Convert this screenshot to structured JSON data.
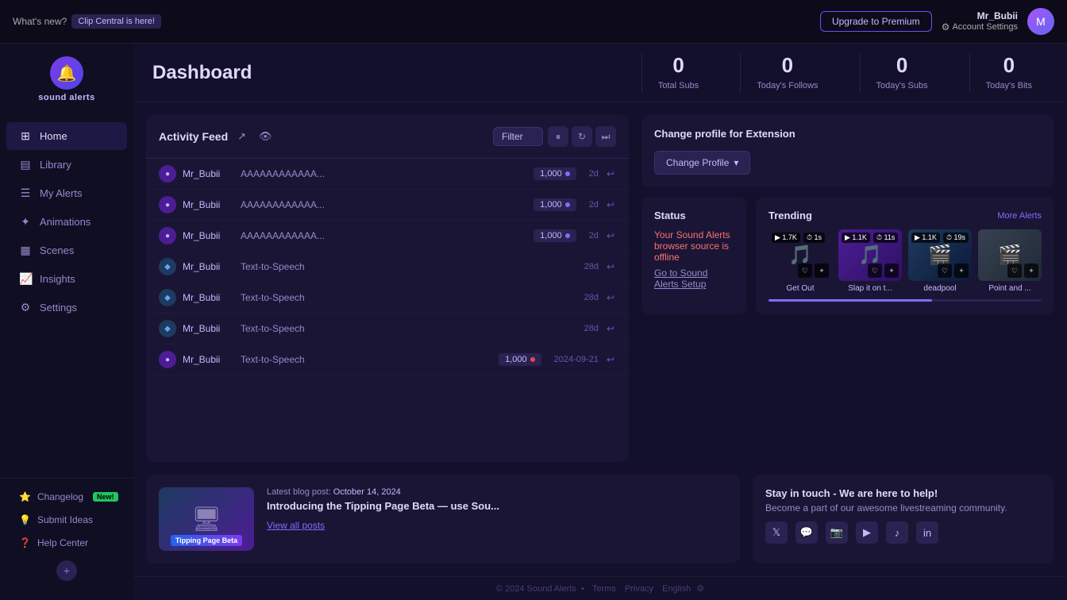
{
  "topbar": {
    "announcement_label": "What's new?",
    "announcement_link": "Clip Central is here!",
    "upgrade_btn": "Upgrade to Premium",
    "username": "Mr_Bubii",
    "account_settings": "Account Settings"
  },
  "sidebar": {
    "logo_text": "sound alerts",
    "items": [
      {
        "id": "home",
        "label": "Home",
        "icon": "⊞",
        "active": true
      },
      {
        "id": "library",
        "label": "Library",
        "icon": "📚"
      },
      {
        "id": "my-alerts",
        "label": "My Alerts",
        "icon": "☰"
      },
      {
        "id": "animations",
        "label": "Animations",
        "icon": "✨"
      },
      {
        "id": "scenes",
        "label": "Scenes",
        "icon": "🎬"
      },
      {
        "id": "insights",
        "label": "Insights",
        "icon": "📊"
      },
      {
        "id": "settings",
        "label": "Settings",
        "icon": "⚙"
      }
    ],
    "bottom_items": [
      {
        "id": "changelog",
        "label": "Changelog",
        "badge": "New!",
        "icon": "⭐"
      },
      {
        "id": "submit-ideas",
        "label": "Submit Ideas",
        "icon": "💡"
      },
      {
        "id": "help-center",
        "label": "Help Center",
        "icon": "❓"
      }
    ]
  },
  "stats": {
    "items": [
      {
        "value": "0",
        "label": "Total Subs"
      },
      {
        "value": "0",
        "label": "Today's Follows"
      },
      {
        "value": "0",
        "label": "Today's Subs"
      },
      {
        "value": "0",
        "label": "Today's Bits"
      }
    ]
  },
  "activity_feed": {
    "title": "Activity Feed",
    "filter_label": "Filter",
    "items": [
      {
        "username": "Mr_Bubii",
        "type": "AAAAAAAAAAAA...",
        "points": "1,000",
        "dot_type": "purple",
        "time": "2d",
        "dot_color": "purple"
      },
      {
        "username": "Mr_Bubii",
        "type": "AAAAAAAAAAAA...",
        "points": "1,000",
        "dot_type": "purple",
        "time": "2d",
        "dot_color": "purple"
      },
      {
        "username": "Mr_Bubii",
        "type": "AAAAAAAAAAAA...",
        "points": "1,000",
        "dot_type": "purple",
        "time": "2d",
        "dot_color": "purple"
      },
      {
        "username": "Mr_Bubii",
        "type": "Text-to-Speech",
        "points": null,
        "dot_type": "diamond",
        "time": "28d",
        "dot_color": null
      },
      {
        "username": "Mr_Bubii",
        "type": "Text-to-Speech",
        "points": null,
        "dot_type": "diamond",
        "time": "28d",
        "dot_color": null
      },
      {
        "username": "Mr_Bubii",
        "type": "Text-to-Speech",
        "points": null,
        "dot_type": "diamond",
        "time": "28d",
        "dot_color": null
      },
      {
        "username": "Mr_Bubii",
        "type": "Text-to-Speech",
        "points": "1,000",
        "dot_type": "purple",
        "time": "2024-09-21",
        "dot_color": "red"
      }
    ]
  },
  "change_profile": {
    "title": "Change profile for Extension",
    "btn_label": "Change Profile"
  },
  "status": {
    "title": "Status",
    "offline_text": "Your Sound Alerts browser source is offline",
    "setup_link": "Go to Sound Alerts Setup"
  },
  "trending": {
    "title": "Trending",
    "more_link": "More Alerts",
    "cards": [
      {
        "name": "Get Out",
        "plays": "1.7K",
        "duration": "1s",
        "icon": "🎵",
        "bg": "dark"
      },
      {
        "name": "Slap it on t...",
        "plays": "1.1K",
        "duration": "11s",
        "icon": "🎵",
        "bg": "purple"
      },
      {
        "name": "deadpool",
        "plays": "1.1K",
        "duration": "19s",
        "icon": "🎬",
        "bg": "blue"
      },
      {
        "name": "Point and ...",
        "plays": "",
        "duration": "",
        "icon": "🎬",
        "bg": "gray"
      }
    ]
  },
  "blog": {
    "label": "Latest blog post:",
    "date": "October 14, 2024",
    "title": "Introducing the Tipping Page Beta — use Sou...",
    "view_link": "View all posts",
    "thumb_tag": "Tipping Page Beta"
  },
  "community": {
    "title": "Stay in touch - We are here to help!",
    "subtitle": "Become a part of our awesome livestreaming community.",
    "socials": [
      "𝕏",
      "💬",
      "📷",
      "▶",
      "♪",
      "in"
    ]
  },
  "footer": {
    "copyright": "© 2024 Sound Alerts",
    "links": [
      "Terms",
      "Privacy",
      "English",
      "⚙"
    ]
  },
  "page_title": "Dashboard"
}
